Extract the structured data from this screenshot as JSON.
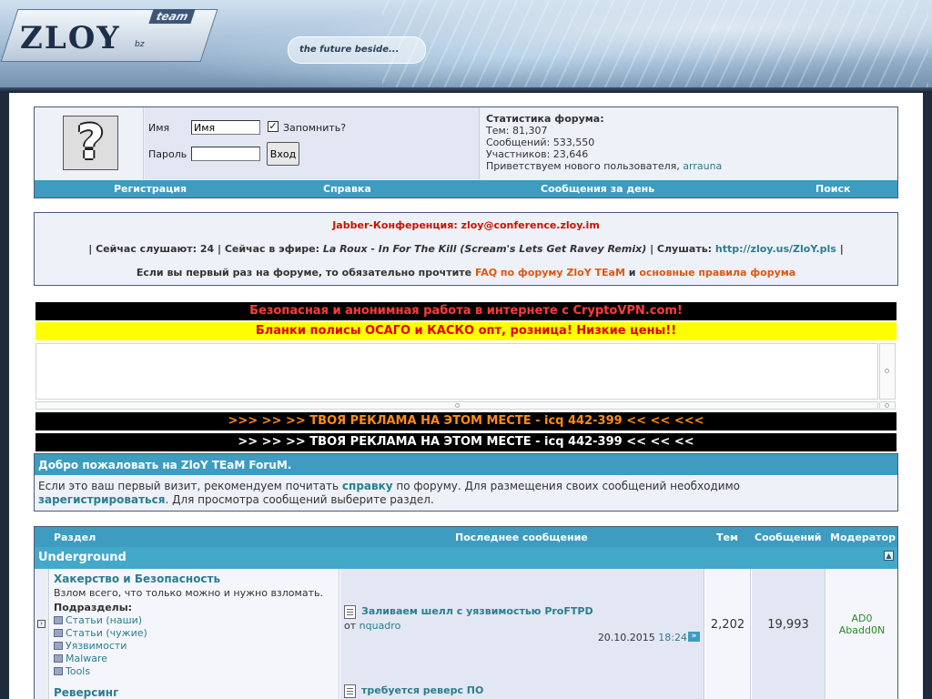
{
  "header": {
    "logo": "ZLOY",
    "logo_team": "team",
    "logo_bz": "bz",
    "tagline": "the future beside..."
  },
  "login": {
    "name_label": "Имя",
    "name_value": "Имя",
    "remember_label": "Запомнить?",
    "remember_checked": true,
    "password_label": "Пароль",
    "password_value": "",
    "login_button": "Вход"
  },
  "stats": {
    "title": "Статистика форума:",
    "topics": "Тем: 81,307",
    "posts": "Сообщений: 533,550",
    "members": "Участников: 23,646",
    "welcome_prefix": "Приветствуем нового пользователя,",
    "newest_user": "arrauna"
  },
  "nav": {
    "register": "Регистрация",
    "help": "Справка",
    "today": "Сообщения за день",
    "search": "Поиск"
  },
  "info": {
    "jabber": "Jabber-Конференция: zloy@conference.zloy.im",
    "listening_prefix": "| Сейчас слушают: 24 | Сейчас в эфире:",
    "now_playing": "La Roux - In For The Kill (Scream's Lets Get Ravey Remix)",
    "listen_label": "| Слушать:",
    "listen_url": "http://zloy.us/ZloY.pls",
    "listen_suffix": "|",
    "first_visit_prefix": "Если вы первый раз на форуме, то обязательно прочтите",
    "faq_link": "FAQ по форуму ZloY TEaM",
    "and": "и",
    "rules_link": "основные правила форума"
  },
  "ads": {
    "vpn": "Безопасная и анонимная работа в интернете с CryptoVPN.com!",
    "osago": "Бланки полисы ОСАГО и КАСКО опт, розница! Низкие цены!!",
    "ad_orange": ">>> >> >> ТВОЯ РЕКЛАМА НА ЭТОМ МЕСТЕ - icq 442-399 << << <<<",
    "ad_white": ">> >> >> ТВОЯ РЕКЛАМА НА ЭТОМ МЕСТЕ - icq 442-399 << << <<"
  },
  "welcome": {
    "title": "Добро пожаловать на ZloY TEaM ForuM.",
    "text1": "Если это ваш первый визит, рекомендуем почитать",
    "help_link": "справку",
    "text2": "по форуму. Для размещения своих сообщений необходимо",
    "register_link": "зарегистрироваться",
    "text3": ". Для просмотра сообщений выберите раздел."
  },
  "forum_table": {
    "headers": {
      "section": "Раздел",
      "last_post": "Последнее сообщение",
      "topics": "Тем",
      "posts": "Сообщений",
      "moderator": "Модератор"
    },
    "category": "Underground",
    "forums": [
      {
        "title": "Хакерство и Безопасность",
        "description": "Взлом всего, что только можно и нужно взломать.",
        "subforums_label": "Подразделы:",
        "subforums": [
          "Статьи (наши)",
          "Статьи (чужие)",
          "Уязвимости",
          "Malware",
          "Tools"
        ],
        "last_title": "Заливаем шелл с уязвимостью ProFTPD",
        "last_from_label": "от",
        "last_from": "nquadro",
        "last_date": "20.10.2015",
        "last_time": "18:24",
        "topics": "2,202",
        "posts": "19,993",
        "moderators": [
          "AD0",
          "Abadd0N"
        ]
      },
      {
        "title": "Реверсинг",
        "last_title": "требуется реверс ПО"
      }
    ]
  },
  "colors": {
    "nav_bar": "#3d9cc0",
    "link": "#2a7e8e",
    "ad_red_bg": "#000000",
    "ad_red_text": "#ff3b3b",
    "ad_yellow_bg": "#ffff00",
    "ad_yellow_text": "#e00000",
    "ad_orange_text": "#ff8c1a"
  }
}
